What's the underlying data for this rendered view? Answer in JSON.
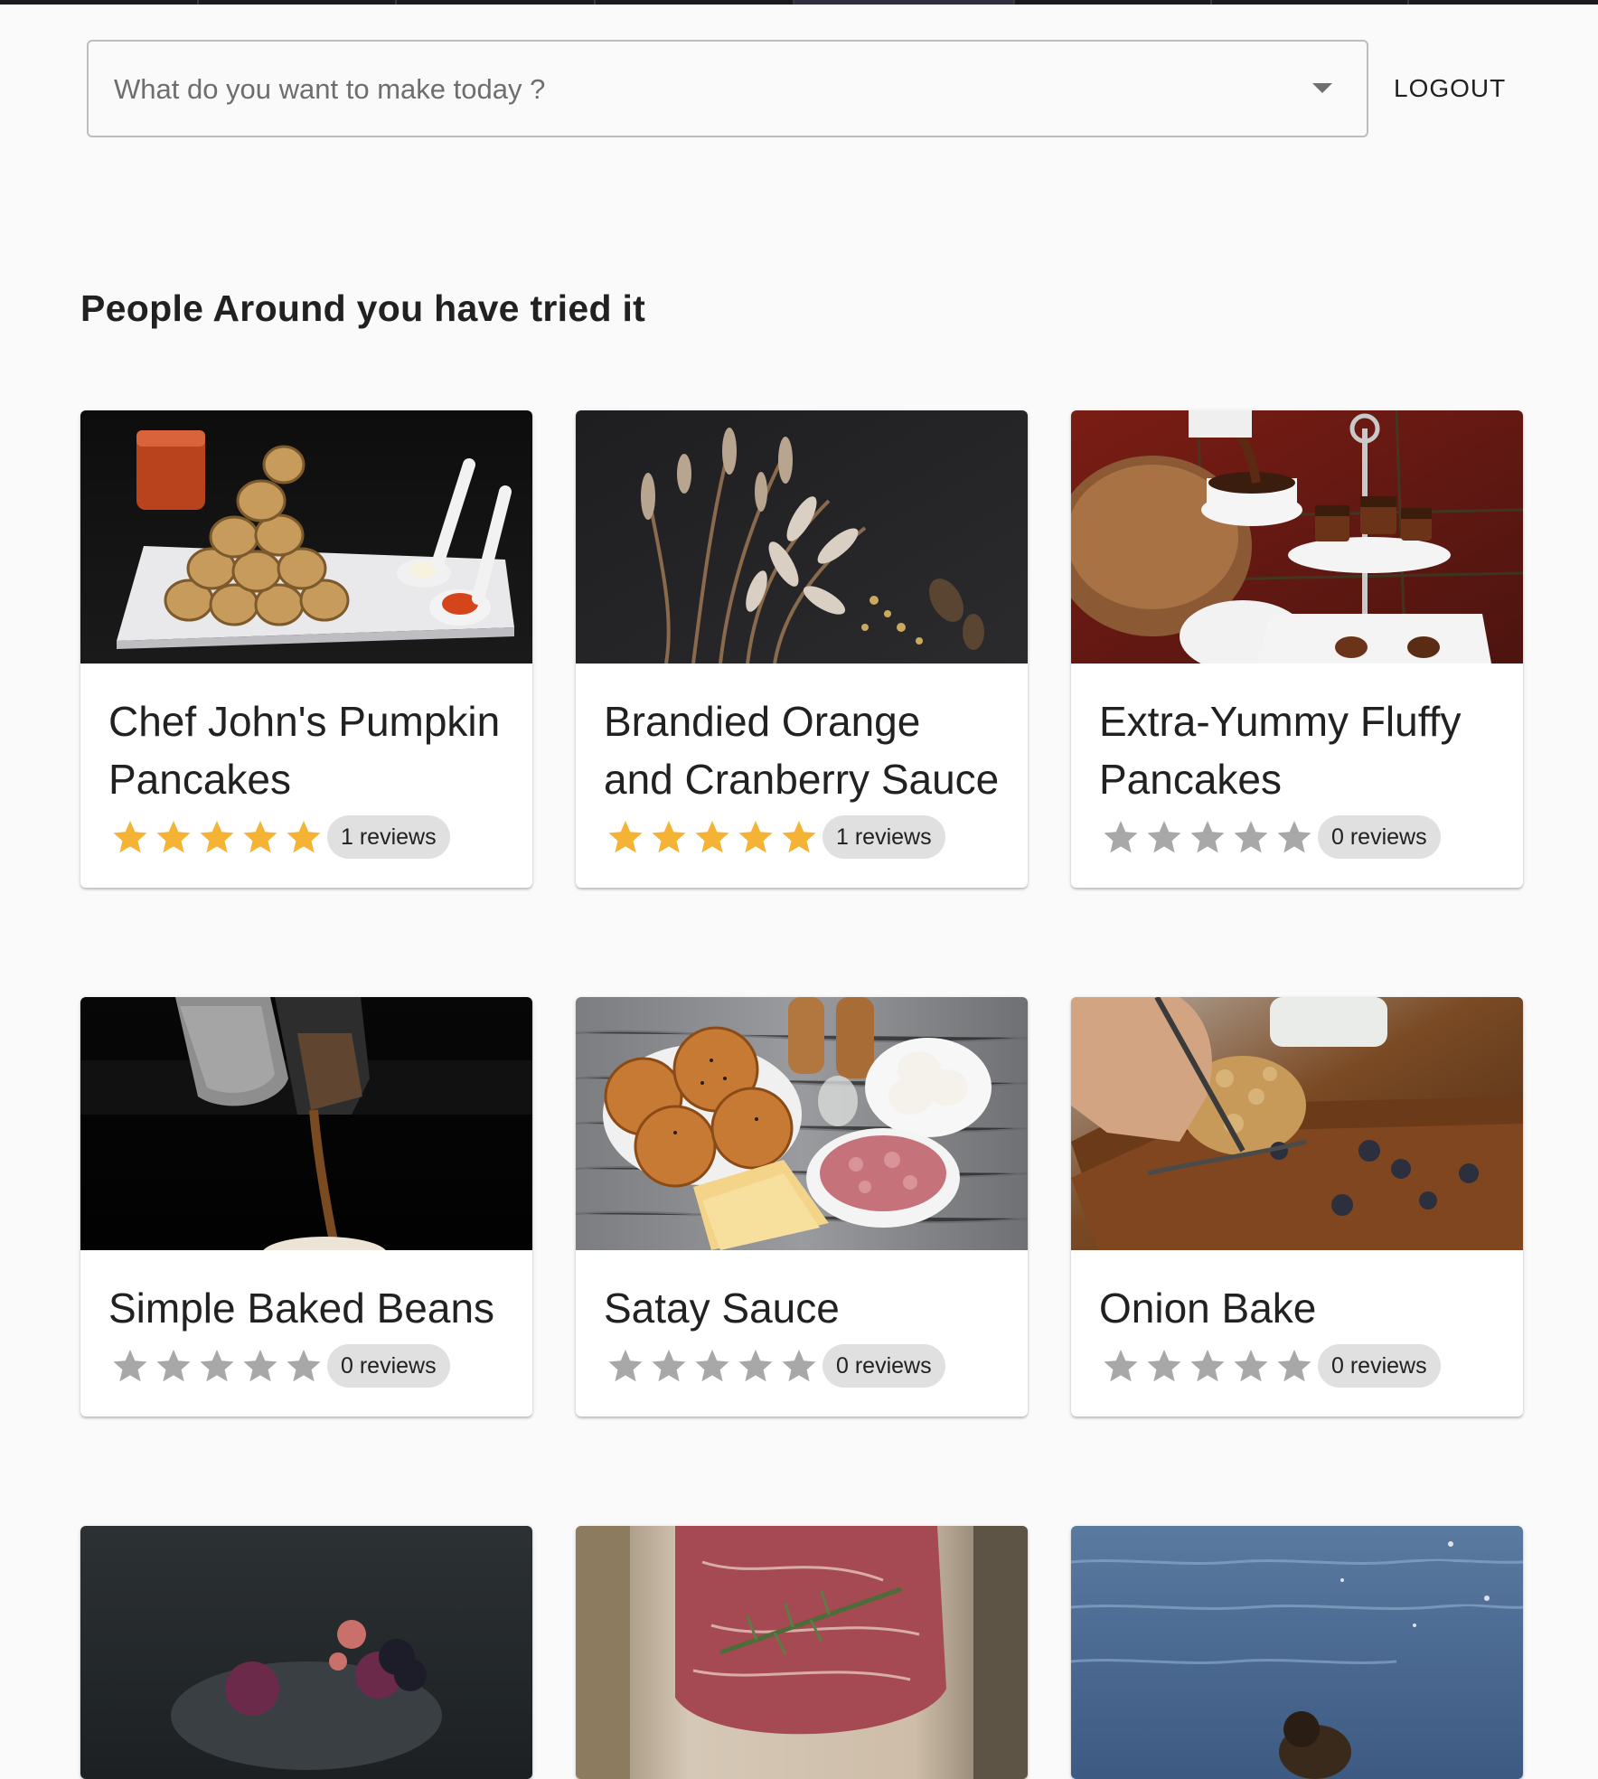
{
  "search": {
    "placeholder": "What do you want to make today ?"
  },
  "header": {
    "logout_label": "LOGOUT"
  },
  "section": {
    "title": "People Around you have tried it"
  },
  "colors": {
    "star_filled": "#f5b335",
    "star_empty": "#a8a8a8",
    "chip_bg": "#e0e0e0",
    "background": "#fafafa"
  },
  "recipes": [
    {
      "title": "Chef John's Pumpkin Pancakes",
      "rating": 5,
      "reviews_label": "1 reviews",
      "image_icon": "pancake-rolls-photo"
    },
    {
      "title": "Brandied Orange and Cranberry Sauce",
      "rating": 5,
      "reviews_label": "1 reviews",
      "image_icon": "dried-flowers-photo"
    },
    {
      "title": "Extra-Yummy Fluffy Pancakes",
      "rating": 0,
      "reviews_label": "0 reviews",
      "image_icon": "desserts-tea-photo"
    },
    {
      "title": "Simple Baked Beans",
      "rating": 0,
      "reviews_label": "0 reviews",
      "image_icon": "coffee-pour-photo"
    },
    {
      "title": "Satay Sauce",
      "rating": 0,
      "reviews_label": "0 reviews",
      "image_icon": "buns-meat-cheese-photo"
    },
    {
      "title": "Onion Bake",
      "rating": 0,
      "reviews_label": "0 reviews",
      "image_icon": "blueberry-cake-photo"
    },
    {
      "title": "",
      "rating": 0,
      "reviews_label": "",
      "image_icon": "dark-dessert-photo"
    },
    {
      "title": "",
      "rating": 0,
      "reviews_label": "",
      "image_icon": "raw-steak-photo"
    },
    {
      "title": "",
      "rating": 0,
      "reviews_label": "",
      "image_icon": "water-duck-photo"
    }
  ]
}
